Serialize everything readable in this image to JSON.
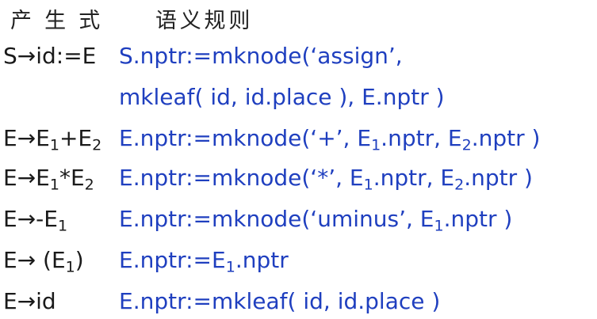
{
  "header": {
    "production": "产 生 式",
    "semantic": "语义规则"
  },
  "rules": [
    {
      "p": "S→id:=E",
      "s": "S.nptr:=mknode(‘assign’,",
      "s2": "mkleaf( id, id.place ),  E.nptr )"
    },
    {
      "p": "E→E1+E2",
      "s": "E.nptr:=mknode(‘+’, E1.nptr, E2.nptr )"
    },
    {
      "p": "E→E1*E2",
      "s": "E.nptr:=mknode(‘*’, E1.nptr, E2.nptr )"
    },
    {
      "p": "E→-E1",
      "s": "E.nptr:=mknode(‘uminus’, E1.nptr )"
    },
    {
      "p": "E→ (E1)",
      "s": "E.nptr:=E1.nptr"
    },
    {
      "p": "E→id",
      "s": "E.nptr:=mkleaf( id, id.place )"
    }
  ]
}
